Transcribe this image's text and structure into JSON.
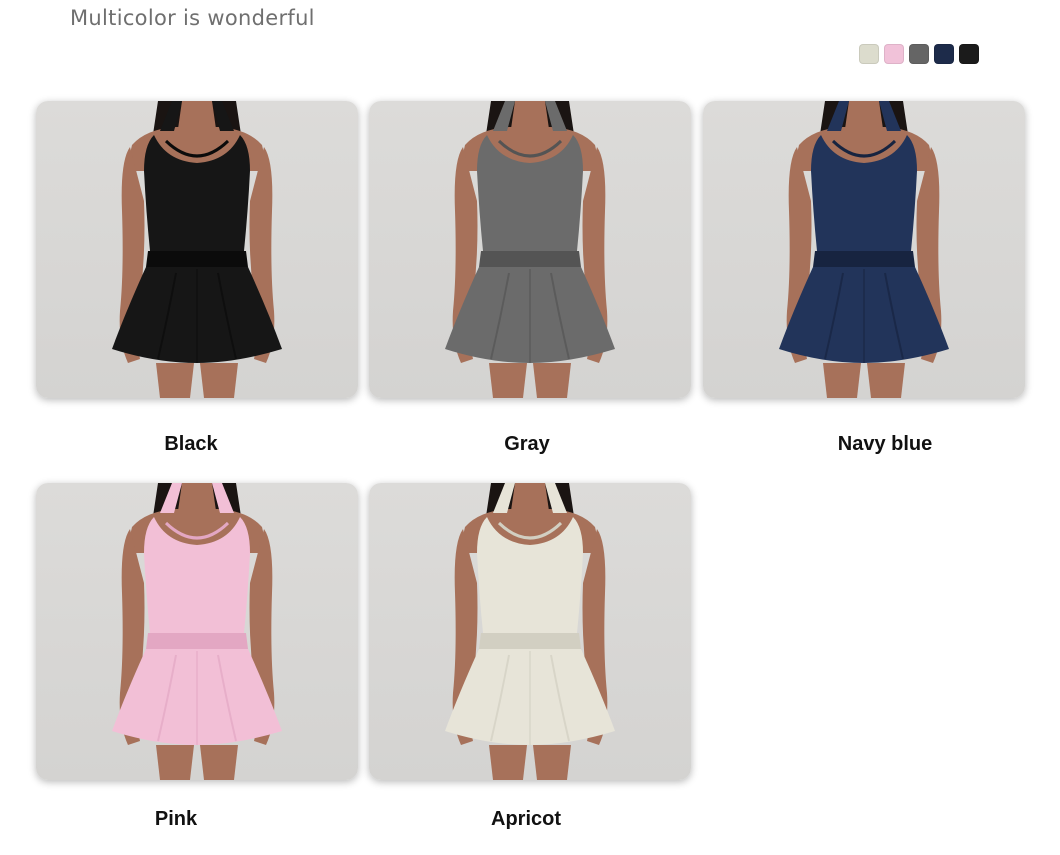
{
  "heading": "Multicolor is wonderful",
  "swatches": [
    {
      "name": "apricot-swatch",
      "color": "#dcdccd"
    },
    {
      "name": "pink-swatch",
      "color": "#f1c2d9"
    },
    {
      "name": "gray-swatch",
      "color": "#656565"
    },
    {
      "name": "navy-swatch",
      "color": "#1d2b4a"
    },
    {
      "name": "black-swatch",
      "color": "#1b1b1b"
    }
  ],
  "products": [
    {
      "label": "Black",
      "dress": "#161616",
      "shade": "#0b0b0b",
      "skin": "#a7715a",
      "hair": "#1a1412"
    },
    {
      "label": "Gray",
      "dress": "#6b6b6b",
      "shade": "#545454",
      "skin": "#a7715a",
      "hair": "#1a1412"
    },
    {
      "label": "Navy blue",
      "dress": "#22345a",
      "shade": "#172440",
      "skin": "#a7715a",
      "hair": "#1a1412"
    },
    {
      "label": "Pink",
      "dress": "#f2bfd6",
      "shade": "#e3a7c3",
      "skin": "#a7715a",
      "hair": "#1a1412"
    },
    {
      "label": "Apricot",
      "dress": "#e7e4d8",
      "shade": "#d2cfc2",
      "skin": "#a7715a",
      "hair": "#1a1412"
    }
  ]
}
